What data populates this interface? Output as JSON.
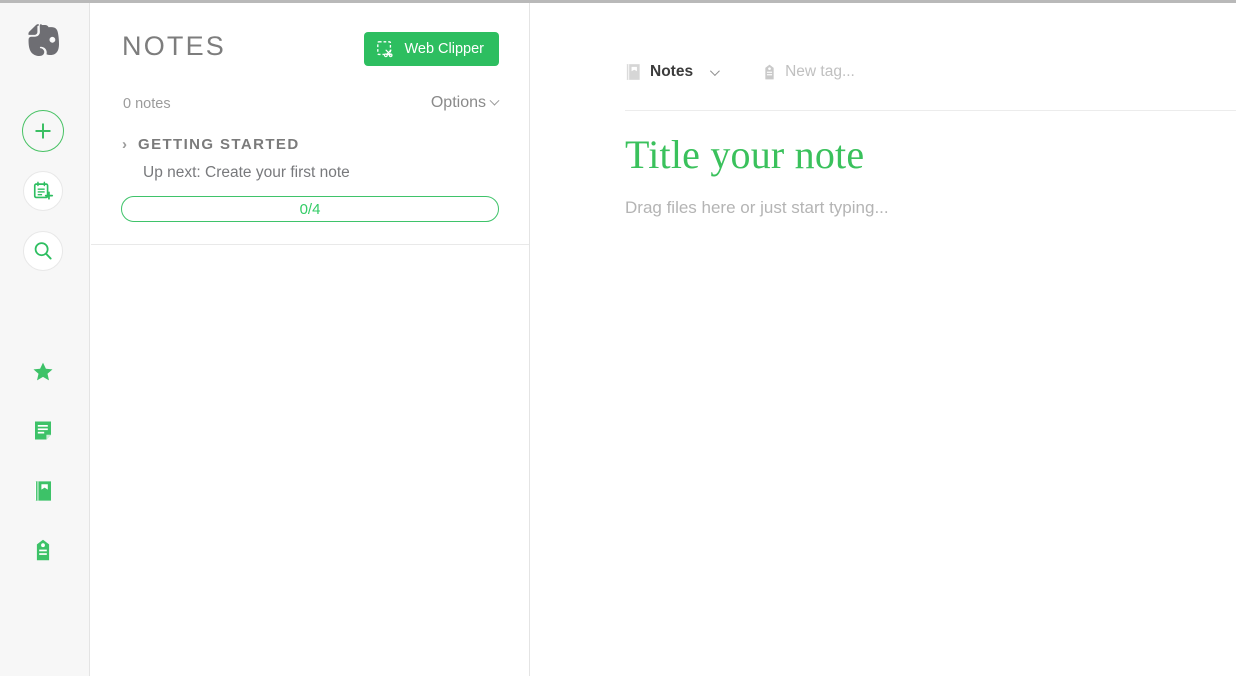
{
  "theme": {
    "green": "#2dbe60",
    "green_light": "#33cc66",
    "gray_text": "#7d7d7d",
    "placeholder": "#b4b4b4",
    "rail_bg": "#f7f7f7",
    "border": "#e4e4e4"
  },
  "rail": {
    "logo": "evernote-elephant-logo",
    "buttons": [
      {
        "name": "new-note-button",
        "icon": "plus-icon",
        "tooltip": "New Note"
      },
      {
        "name": "new-clip-button",
        "icon": "new-note-page-icon",
        "tooltip": "New Note from Clipper"
      },
      {
        "name": "search-button",
        "icon": "search-icon",
        "tooltip": "Search"
      }
    ],
    "nav": [
      {
        "name": "shortcuts-nav",
        "icon": "star-icon",
        "label": "Shortcuts"
      },
      {
        "name": "notes-nav",
        "icon": "note-icon",
        "label": "Notes"
      },
      {
        "name": "notebooks-nav",
        "icon": "notebook-icon",
        "label": "Notebooks"
      },
      {
        "name": "tags-nav",
        "icon": "tag-icon",
        "label": "Tags"
      }
    ]
  },
  "list_panel": {
    "title": "NOTES",
    "web_clipper_label": "Web Clipper",
    "web_clipper_icon": "web-clipper-scissors-icon",
    "note_count": "0 notes",
    "options_label": "Options",
    "options_icon": "chevron-down-icon",
    "getting_started": {
      "arrow": "›",
      "heading": "GETTING STARTED",
      "up_next": "Up next: Create your first note",
      "progress": "0/4"
    }
  },
  "editor": {
    "notebook_icon": "notebook-icon",
    "notebook_name": "Notes",
    "notebook_chevron": "chevron-down-icon",
    "tag_icon": "tag-icon",
    "tag_placeholder": "New tag...",
    "title_placeholder": "Title your note",
    "body_placeholder": "Drag files here or just start typing..."
  }
}
